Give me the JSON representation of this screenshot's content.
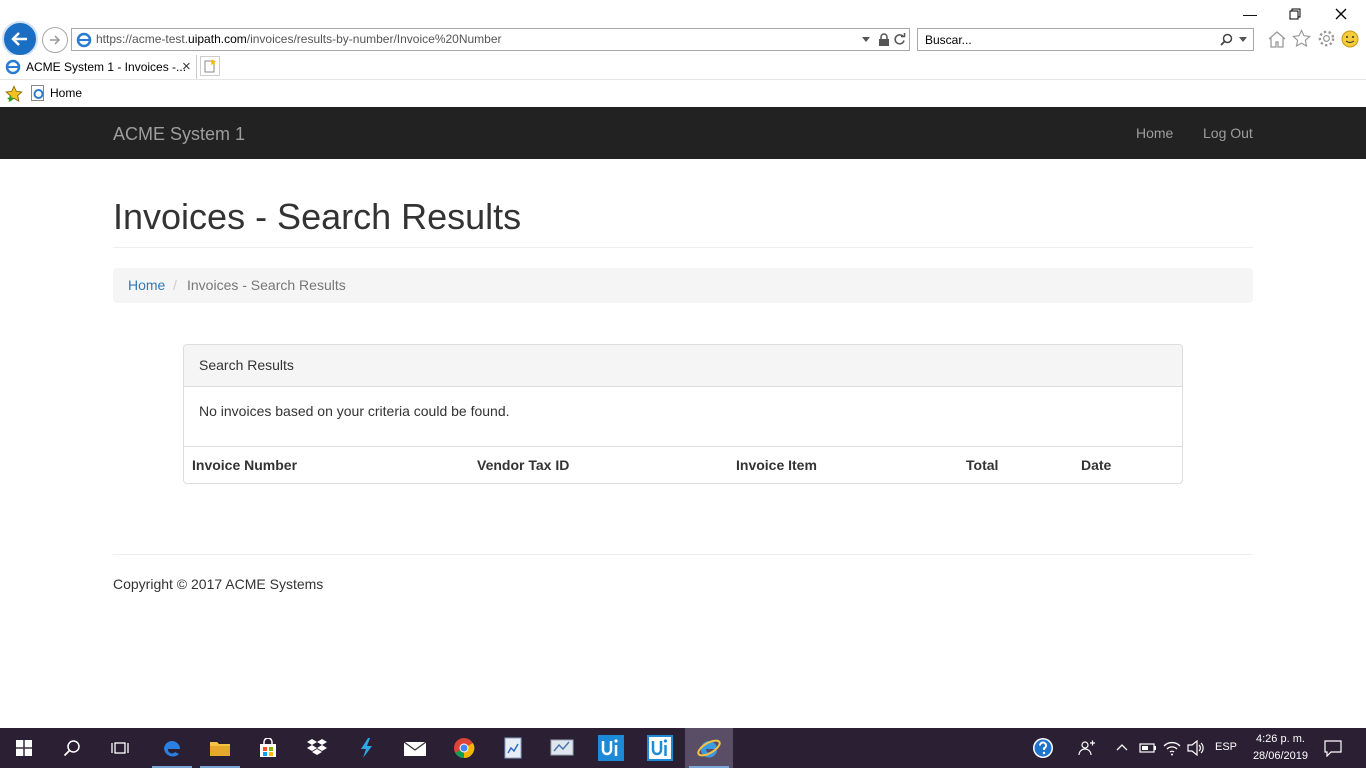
{
  "browser": {
    "url_prefix": "https://acme-test.",
    "url_host": "uipath.com",
    "url_path": "/invoices/results-by-number/Invoice%20Number",
    "search_placeholder": "Buscar...",
    "tab_title": "ACME System 1 - Invoices -...",
    "tab_close": "×",
    "favorites": [
      {
        "label": "Home"
      }
    ]
  },
  "navbar": {
    "brand": "ACME System 1",
    "links": [
      {
        "label": "Home"
      },
      {
        "label": "Log Out"
      }
    ]
  },
  "page": {
    "title": "Invoices - Search Results",
    "breadcrumb": {
      "home": "Home",
      "separator": "/",
      "current": "Invoices - Search Results"
    }
  },
  "panel": {
    "heading": "Search Results",
    "message": "No invoices based on your criteria could be found.",
    "columns": [
      "Invoice Number",
      "Vendor Tax ID",
      "Invoice Item",
      "Total",
      "Date"
    ]
  },
  "footer": {
    "copyright": "Copyright © 2017 ACME Systems"
  },
  "taskbar": {
    "lang": "ESP",
    "time": "4:26 p. m.",
    "date": "28/06/2019",
    "apps": [
      "windows-start",
      "search",
      "task-view",
      "edge",
      "file-explorer",
      "store",
      "dropbox",
      "uipath-studio",
      "mail",
      "chrome",
      "uipath-app",
      "uipath-app-2",
      "uipath-robot",
      "uipath-orchestrator",
      "internet-explorer"
    ]
  },
  "colors": {
    "navbar": "#222222",
    "link": "#337ab7",
    "taskbar": "#2b1f33",
    "back_button": "#1a6fc4"
  }
}
